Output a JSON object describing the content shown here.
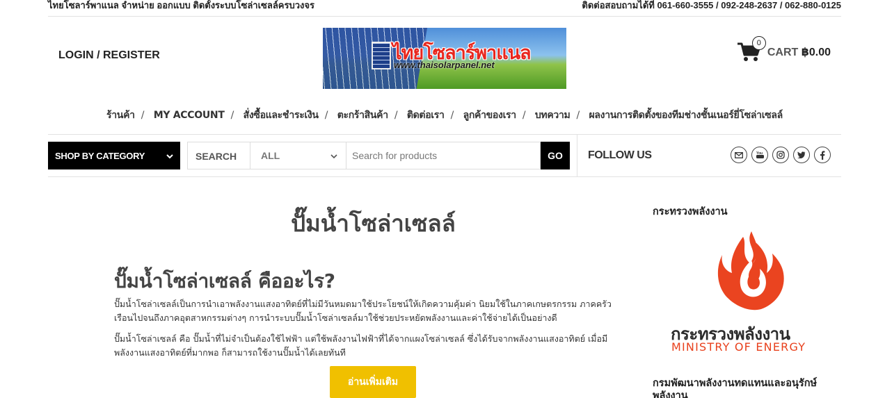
{
  "topbar": {
    "left_text": "ไทยโซลาร์พาแนล จำหน่าย ออกแบบ ติดตั้งระบบโซล่าเซลล์ครบวงจร",
    "right_text": "ติดต่อสอบถามได้ที่ 061-660-3555 / 092-248-2637 / 062-880-0125"
  },
  "header": {
    "login_label": "LOGIN / REGISTER",
    "logo": {
      "title": "ไทยโซลาร์พาแนล",
      "url_text": "www.thaisolarpanel.net"
    },
    "cart": {
      "count": "0",
      "label": "CART",
      "amount": "฿0.00",
      "icon": "cart-icon"
    }
  },
  "nav": {
    "items": [
      "ร้านค้า",
      "MY ACCOUNT",
      "สั่งซื้อและชำระเงิน",
      "ตะกร้าสินค้า",
      "ติดต่อเรา",
      "ลูกค้าของเรา",
      "บทความ",
      "ผลงานการติดตั้งของทีมช่างชั้นเนอร์ยี่โซล่าเซลล์"
    ],
    "separator": "/"
  },
  "toolbar": {
    "category_label": "SHOP BY CATEGORY",
    "search_label": "SEARCH",
    "category_select": "ALL",
    "search_placeholder": "Search for products",
    "go_label": "GO",
    "follow_label": "FOLLOW US",
    "social_icons": [
      "email-icon",
      "youtube-icon",
      "instagram-icon",
      "twitter-icon",
      "facebook-icon"
    ]
  },
  "main": {
    "page_title": "ปั๊มน้ำโซล่าเซลล์",
    "subtitle": "ปั๊มน้ำโซล่าเซลล์ คืออะไร?",
    "paragraph1": "ปั๊มน้ำโซล่าเซลล์เป็นการนำเอาพลังงานแสงอาทิตย์ที่ไม่มีวันหมดมาใช้ประโยชน์ให้เกิดความคุ้มค่า นิยมใช้ในภาคเกษตรกรรม ภาคครัวเรือนไปจนถึงภาคอุตสาหกรรมต่างๆ การนำระบบปั๊มน้ำโซล่าเซลล์มาใช้ช่วยประหยัดพลังงานและค่าใช้จ่ายได้เป็นอย่างดี",
    "paragraph2": "ปั๊มน้ำโซล่าเซลล์ คือ ปั๊มน้ำที่ไม่จำเป็นต้องใช้ไฟฟ้า แต่ใช้พลังงานไฟฟ้าที่ได้จากแผงโซล่าเซลล์ ซึ่งได้รับจากพลังงานแสงอาทิตย์ เมื่อมีพลังงานแสงอาทิตย์ที่มากพอ ก็สามารถใช้งานปั๊มน้ำได้เลยทันที",
    "read_more": "อ่านเพิ่มเติม"
  },
  "sidebar": {
    "heading1": "กระทรวงพลังงาน",
    "ministry_logo": {
      "thai_name": "กระทรวงพลังงาน",
      "english_name": "MINISTRY OF ENERGY"
    },
    "heading2": "กรมพัฒนาพลังงานทดแทนและอนุรักษ์พลังงาน"
  },
  "colors": {
    "accent_yellow": "#f0c000",
    "black": "#000000",
    "energy_red": "#e8401c"
  }
}
